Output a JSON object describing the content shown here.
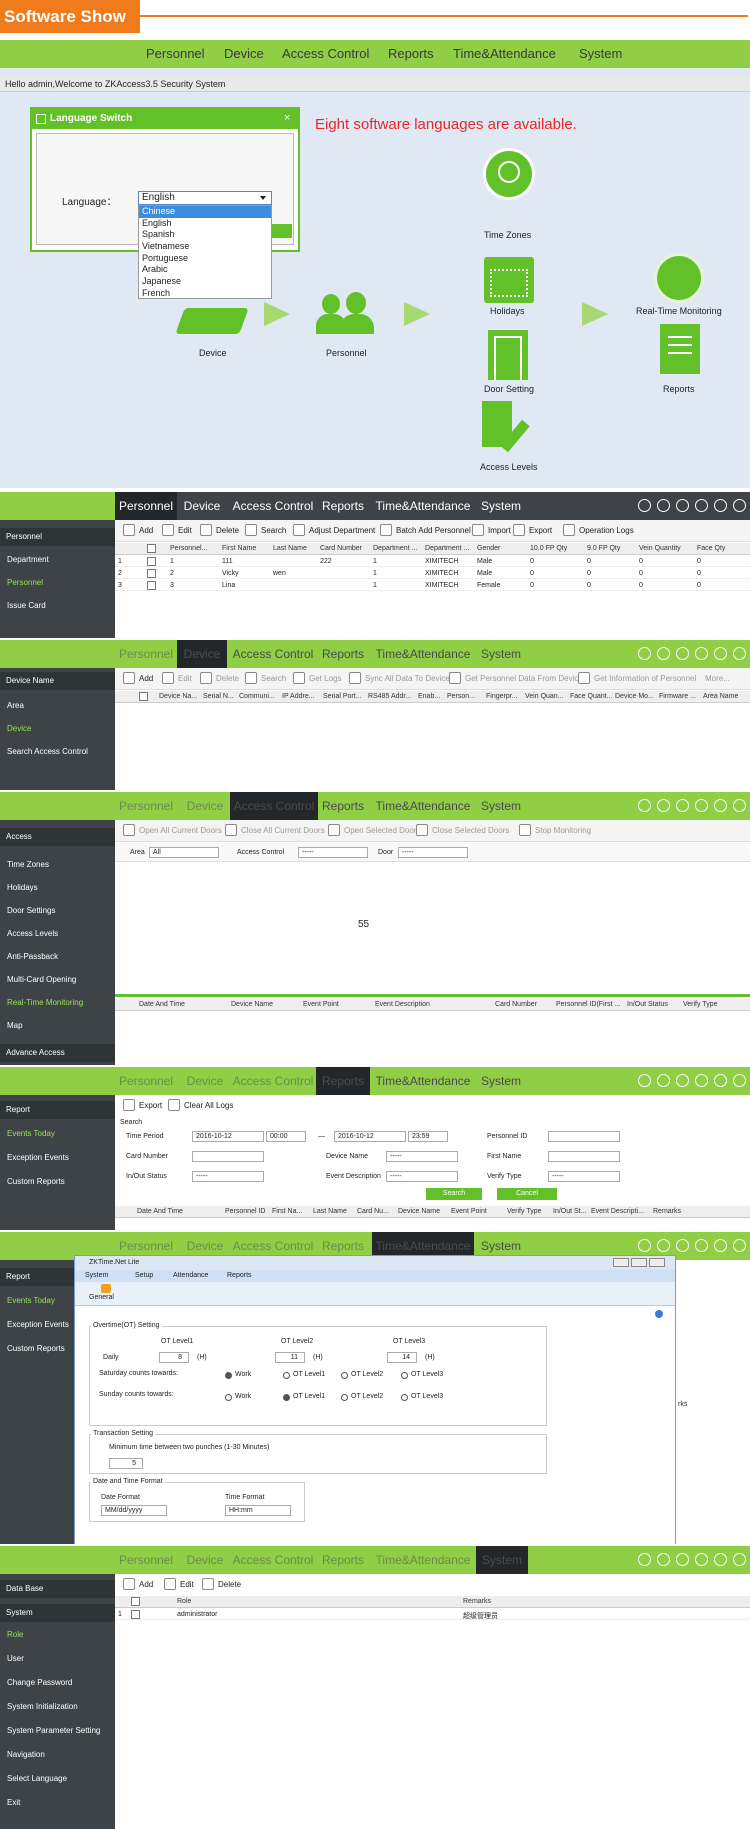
{
  "header": {
    "title": "Software Show"
  },
  "intro": {
    "nav": [
      "Personnel",
      "Device",
      "Access Control",
      "Reports",
      "Time&Attendance",
      "System"
    ],
    "welcome": "Hello admin,Welcome to ZKAccess3.5 Security System",
    "dialog_title": "Language Switch",
    "language_label": "Language：",
    "selected": "English",
    "options": [
      "Chinese",
      "English",
      "Spanish",
      "Vietnamese",
      "Portuguese",
      "Arabic",
      "Japanese",
      "French"
    ],
    "callout": "Eight software languages are available.",
    "labels": {
      "time_zones": "Time Zones",
      "holidays": "Holidays",
      "door_setting": "Door Setting",
      "access_levels": "Access Levels",
      "device": "Device",
      "personnel": "Personnel",
      "realtime": "Real-Time Monitoring",
      "reports": "Reports"
    }
  },
  "tabs": [
    "Personnel",
    "Device",
    "Access Control",
    "Reports",
    "Time&Attendance",
    "System"
  ],
  "personnel": {
    "side_group": "Personnel",
    "items": [
      "Department",
      "Personnel",
      "Issue Card"
    ],
    "toolbar": [
      "Add",
      "Edit",
      "Delete",
      "Search",
      "Adjust Department",
      "Batch Add Personnel",
      "Import",
      "Export",
      "Operation Logs"
    ],
    "cols": [
      "Personnel...",
      "First Name",
      "Last Name",
      "Card Number",
      "Department ...",
      "Department ...",
      "Gender",
      "10.0 FP Qty",
      "9.0 FP Qty",
      "Vein Quantity",
      "Face Qty"
    ],
    "rows": [
      [
        "1",
        "1",
        "111",
        "",
        "222",
        "1",
        "XIMITECH",
        "Male",
        "0",
        "0",
        "0",
        "0"
      ],
      [
        "2",
        "2",
        "Vicky",
        "wen",
        "",
        "1",
        "XIMITECH",
        "Male",
        "0",
        "0",
        "0",
        "0"
      ],
      [
        "3",
        "3",
        "Lina",
        "",
        "",
        "1",
        "XIMITECH",
        "Female",
        "0",
        "0",
        "0",
        "0"
      ]
    ]
  },
  "device": {
    "side_group": "Device Name",
    "items": [
      "Area",
      "Device",
      "Search Access Control"
    ],
    "toolbar": [
      "Add",
      "Edit",
      "Delete",
      "Search",
      "Get Logs",
      "Sync All Data To Device",
      "Get Personnel Data From Device",
      "Get Information of Personnel",
      "More..."
    ],
    "cols": [
      "Device Na...",
      "Serial N...",
      "Communi...",
      "IP Addre...",
      "Serial Port...",
      "RS485 Addr...",
      "Enab...",
      "Person...",
      "Fingerpr...",
      "Vein Quan...",
      "Face Quant...",
      "Device Mo...",
      "Firmware ...",
      "Area Name"
    ]
  },
  "access": {
    "side_group": "Access",
    "items": [
      "Time Zones",
      "Holidays",
      "Door Settings",
      "Access Levels",
      "Anti-Passback",
      "Multi-Card Opening",
      "Real-Time Monitoring",
      "Map"
    ],
    "side_bottom": "Advance Access",
    "toolbar": [
      "Open All Current Doors",
      "Close All Current Doors",
      "Open Selected Doors",
      "Close Selected Doors",
      "Stop Monitoring"
    ],
    "filter": {
      "area_label": "Area",
      "area_value": "All",
      "ac_label": "Access Control",
      "ac_value": "-----",
      "door_label": "Door",
      "door_value": "-----"
    },
    "center_text": "55",
    "cols": [
      "Date And Time",
      "Device Name",
      "Event Point",
      "Event Description",
      "Card Number",
      "Personnel ID(First ...",
      "In/Out Status",
      "Verify Type"
    ]
  },
  "reports": {
    "side_group": "Report",
    "items": [
      "Events Today",
      "Exception Events",
      "Custom Reports"
    ],
    "toolbar": [
      "Export",
      "Clear All Logs"
    ],
    "search_label": "Search",
    "time_period": "Time Period",
    "date1": "2016-10-12",
    "time1": "00:00",
    "date2": "2016-10-12",
    "time2": "23:59",
    "personnel_id": "Personnel ID",
    "card_number": "Card Number",
    "device_name": "Device Name",
    "first_name": "First Name",
    "inout": "In/Out Status",
    "event_desc": "Event Description",
    "verify": "Verify Type",
    "dash": "-----",
    "search_btn": "Search",
    "cancel_btn": "Cancel",
    "cols": [
      "Date And Time",
      "Personnel ID",
      "First Na...",
      "Last Name",
      "Card Nu...",
      "Device Name",
      "Event Point",
      "Verify Type",
      "In/Out St...",
      "Event Descripti...",
      "Remarks"
    ]
  },
  "ta": {
    "side_group": "Report",
    "items": [
      "Events Today",
      "Exception Events",
      "Custom Reports"
    ],
    "win_title": "ZKTime.Net Lite",
    "menu": [
      "System",
      "Setup",
      "Attendance",
      "Reports"
    ],
    "general": "General",
    "ot_title": "Overtime(OT) Setting",
    "levels": [
      "OT Level1",
      "OT Level2",
      "OT Level3"
    ],
    "daily": "Daily",
    "v1": "8",
    "v2": "11",
    "v3": "14",
    "h": "(H)",
    "sat": "Saturday counts towards:",
    "sun": "Sunday counts towards:",
    "radio": [
      "Work",
      "OT Level1",
      "OT Level2",
      "OT Level3"
    ],
    "tx_title": "Transaction Setting",
    "min_label": "Minimum time between two punches (1-30 Minutes)",
    "min_val": "5",
    "dt_title": "Date and Time Format",
    "date_fmt": "Date Format",
    "time_fmt": "Time Format",
    "date_val": "MM/dd/yyyy",
    "time_val": "HH:mm",
    "side_cut": "rks"
  },
  "system": {
    "groups": [
      "Data Base",
      "System"
    ],
    "items": [
      "Role",
      "User",
      "Change Password",
      "System Initialization",
      "System Parameter Setting",
      "Navigation",
      "Select Language",
      "Exit"
    ],
    "toolbar": [
      "Add",
      "Edit",
      "Delete"
    ],
    "cols": [
      "Role",
      "Remarks"
    ],
    "row": [
      "1",
      "administrator",
      "超级管理员"
    ]
  }
}
